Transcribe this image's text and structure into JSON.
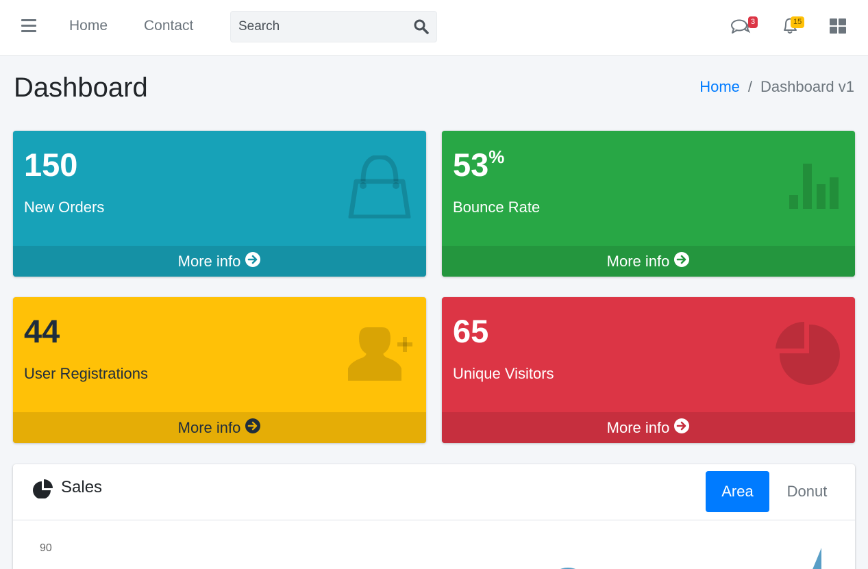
{
  "navbar": {
    "links": [
      "Home",
      "Contact"
    ],
    "search_placeholder": "Search",
    "messages_badge": "3",
    "notifications_badge": "15",
    "icons": [
      "bars-icon",
      "search-icon",
      "comments-icon",
      "bell-icon",
      "th-large-icon"
    ]
  },
  "header": {
    "title": "Dashboard",
    "breadcrumb": [
      "Home",
      "Dashboard v1"
    ]
  },
  "boxes": [
    {
      "value": "150",
      "suffix": "",
      "label": "New Orders",
      "footer": "More info",
      "icon": "shopping-bag-icon",
      "color": "#17a2b8"
    },
    {
      "value": "53",
      "suffix": "%",
      "label": "Bounce Rate",
      "footer": "More info",
      "icon": "bar-chart-icon",
      "color": "#28a745"
    },
    {
      "value": "44",
      "suffix": "",
      "label": "User Registrations",
      "footer": "More info",
      "icon": "user-plus-icon",
      "color": "#ffc107"
    },
    {
      "value": "65",
      "suffix": "",
      "label": "Unique Visitors",
      "footer": "More info",
      "icon": "pie-chart-icon",
      "color": "#dc3545"
    }
  ],
  "sales": {
    "title": "Sales",
    "tabs": [
      "Area",
      "Donut"
    ],
    "active_tab": "Area",
    "y_tick": "90"
  },
  "colors": {
    "primary": "#007bff",
    "chart_fill": "#3c8dbc"
  }
}
